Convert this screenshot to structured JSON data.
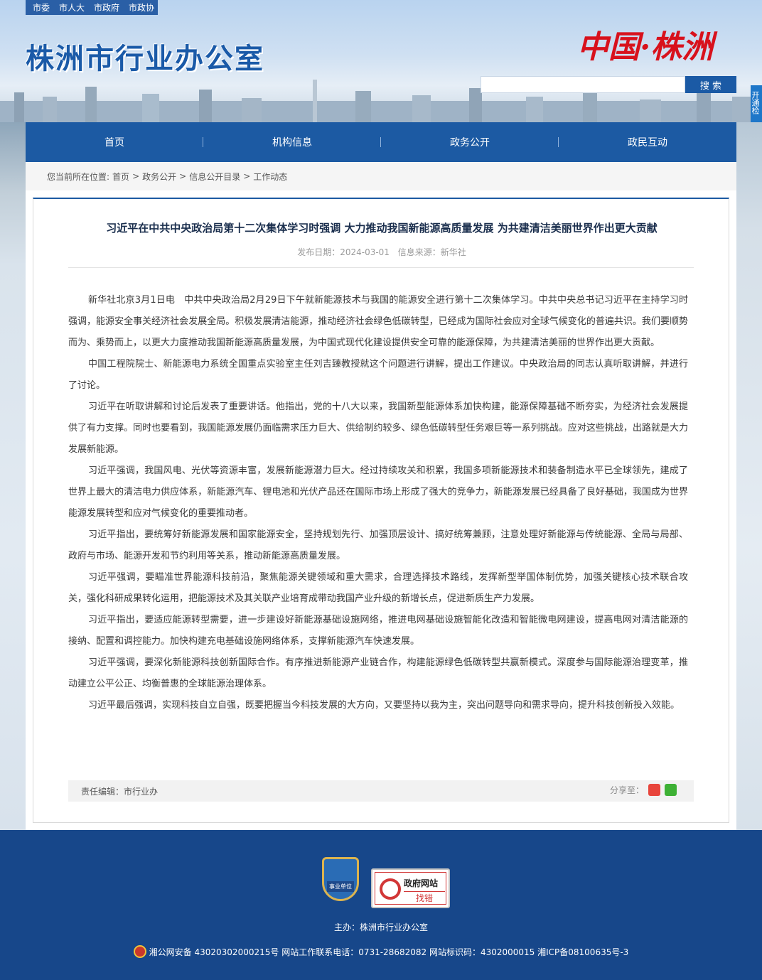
{
  "header": {
    "top_links": [
      "市委",
      "市人大",
      "市政府",
      "市政协"
    ],
    "site_title": "株洲市行业办公室",
    "logo_text": "中国·株洲",
    "search_placeholder": "",
    "search_button": "搜 索",
    "side_tab": "开通检"
  },
  "nav": {
    "items": [
      {
        "label": "首页"
      },
      {
        "label": "机构信息"
      },
      {
        "label": "政务公开"
      },
      {
        "label": "政民互动"
      }
    ]
  },
  "breadcrumb": {
    "prefix": "您当前所在位置:",
    "items": [
      "首页",
      "政务公开",
      "信息公开目录",
      "工作动态"
    ],
    "separator": ">"
  },
  "article": {
    "title": "习近平在中共中央政治局第十二次集体学习时强调 大力推动我国新能源高质量发展 为共建清洁美丽世界作出更大贡献",
    "date_label": "发布日期：2024-03-01",
    "source_label": "信息来源：新华社",
    "paragraphs": [
      "新华社北京3月1日电　中共中央政治局2月29日下午就新能源技术与我国的能源安全进行第十二次集体学习。中共中央总书记习近平在主持学习时强调，能源安全事关经济社会发展全局。积极发展清洁能源，推动经济社会绿色低碳转型，已经成为国际社会应对全球气候变化的普遍共识。我们要顺势而为、乘势而上，以更大力度推动我国新能源高质量发展，为中国式现代化建设提供安全可靠的能源保障，为共建清洁美丽的世界作出更大贡献。",
      "中国工程院院士、新能源电力系统全国重点实验室主任刘吉臻教授就这个问题进行讲解，提出工作建议。中央政治局的同志认真听取讲解，并进行了讨论。",
      "习近平在听取讲解和讨论后发表了重要讲话。他指出，党的十八大以来，我国新型能源体系加快构建，能源保障基础不断夯实，为经济社会发展提供了有力支撑。同时也要看到，我国能源发展仍面临需求压力巨大、供给制约较多、绿色低碳转型任务艰巨等一系列挑战。应对这些挑战，出路就是大力发展新能源。",
      "习近平强调，我国风电、光伏等资源丰富，发展新能源潜力巨大。经过持续攻关和积累，我国多项新能源技术和装备制造水平已全球领先，建成了世界上最大的清洁电力供应体系，新能源汽车、锂电池和光伏产品还在国际市场上形成了强大的竞争力，新能源发展已经具备了良好基础，我国成为世界能源发展转型和应对气候变化的重要推动者。",
      "习近平指出，要统筹好新能源发展和国家能源安全，坚持规划先行、加强顶层设计、搞好统筹兼顾，注意处理好新能源与传统能源、全局与局部、政府与市场、能源开发和节约利用等关系，推动新能源高质量发展。",
      "习近平强调，要瞄准世界能源科技前沿，聚焦能源关键领域和重大需求，合理选择技术路线，发挥新型举国体制优势，加强关键核心技术联合攻关，强化科研成果转化运用，把能源技术及其关联产业培育成带动我国产业升级的新增长点，促进新质生产力发展。",
      "习近平指出，要适应能源转型需要，进一步建设好新能源基础设施网络，推进电网基础设施智能化改造和智能微电网建设，提高电网对清洁能源的接纳、配置和调控能力。加快构建充电基础设施网络体系，支撑新能源汽车快速发展。",
      "习近平强调，要深化新能源科技创新国际合作。有序推进新能源产业链合作，构建能源绿色低碳转型共赢新模式。深度参与国际能源治理变革，推动建立公平公正、均衡普惠的全球能源治理体系。",
      "习近平最后强调，实现科技自立自强，既要把握当今科技发展的大方向，又要坚持以我为主，突出问题导向和需求导向，提升科技创新投入效能。"
    ],
    "editor_label": "责任编辑：市行业办",
    "share_label": "分享至："
  },
  "footer": {
    "badge_text": "事业单位",
    "jiucuo_top": "政府网站",
    "jiucuo_bottom": "找错",
    "host": "主办：株洲市行业办公室",
    "info": "湘公网安备 43020302000215号 网站工作联系电话：0731-28682082 网站标识码：4302000015 湘ICP备08100635号-3"
  },
  "colors": {
    "brand_blue": "#1c5aa3",
    "footer_blue": "#17478a",
    "logo_red": "#d8111c"
  }
}
